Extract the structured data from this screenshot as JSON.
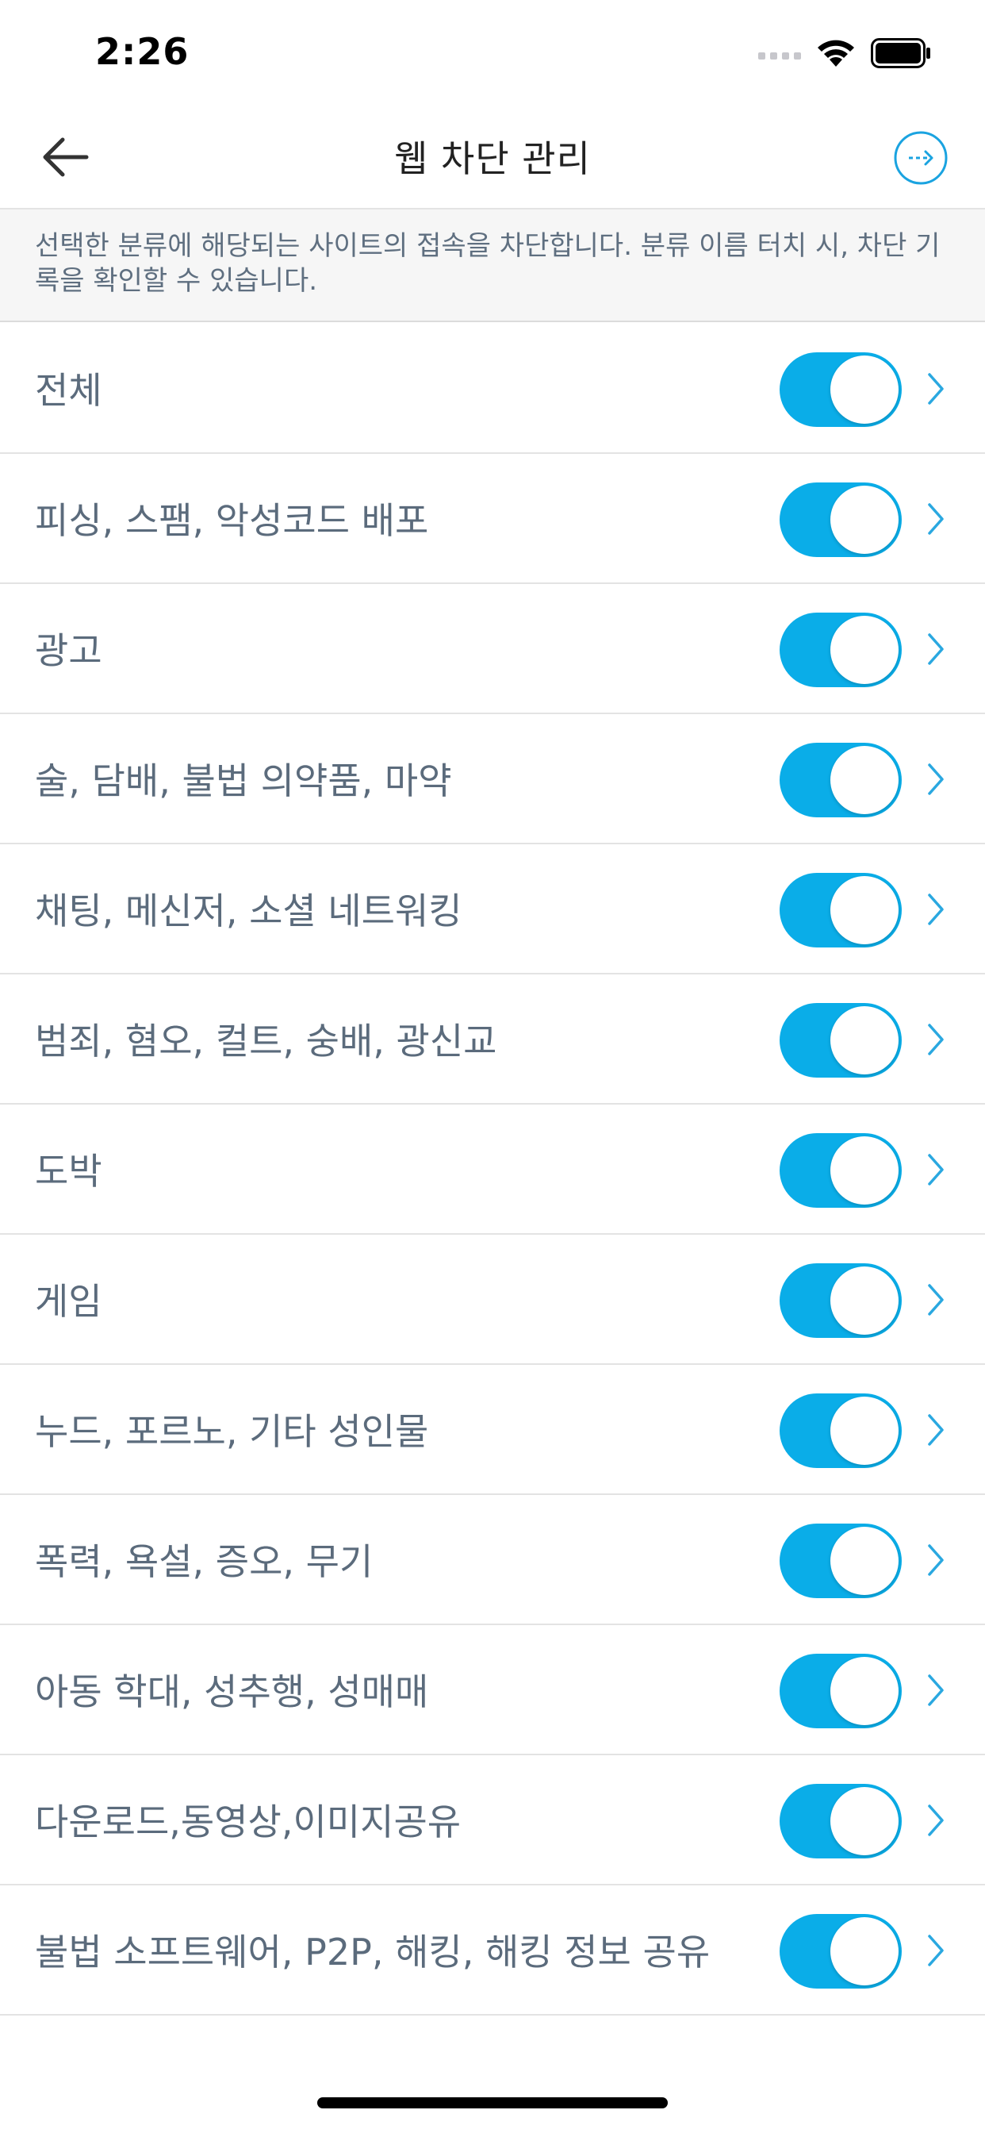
{
  "status_bar": {
    "time": "2:26"
  },
  "header": {
    "title": "웹 차단 관리"
  },
  "description": "선택한 분류에 해당되는 사이트의 접속을 차단합니다. 분류 이름 터치 시, 차단 기록을 확인할 수 있습니다.",
  "colors": {
    "accent": "#0aade8",
    "label": "#5b6b7c"
  },
  "categories": [
    {
      "label": "전체",
      "enabled": true
    },
    {
      "label": "피싱, 스팸, 악성코드 배포",
      "enabled": true
    },
    {
      "label": "광고",
      "enabled": true
    },
    {
      "label": "술, 담배, 불법 의약품, 마약",
      "enabled": true
    },
    {
      "label": "채팅, 메신저, 소셜 네트워킹",
      "enabled": true
    },
    {
      "label": "범죄, 혐오, 컬트, 숭배, 광신교",
      "enabled": true
    },
    {
      "label": "도박",
      "enabled": true
    },
    {
      "label": "게임",
      "enabled": true
    },
    {
      "label": "누드, 포르노, 기타 성인물",
      "enabled": true
    },
    {
      "label": "폭력, 욕설, 증오, 무기",
      "enabled": true
    },
    {
      "label": "아동 학대, 성추행, 성매매",
      "enabled": true
    },
    {
      "label": "다운로드,동영상,이미지공유",
      "enabled": true
    },
    {
      "label": "불법 소프트웨어, P2P, 해킹, 해킹 정보 공유",
      "enabled": true
    }
  ]
}
